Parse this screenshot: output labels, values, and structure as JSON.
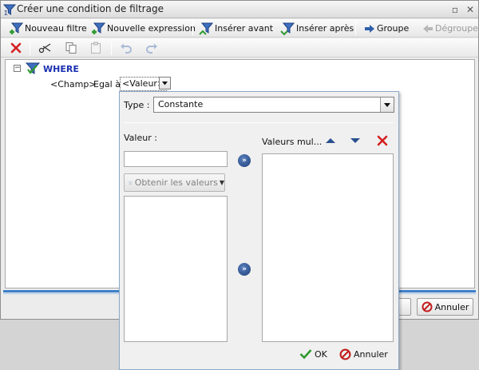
{
  "window": {
    "title": "Créer une condition de filtrage",
    "minimize_glyph": "▫",
    "close_glyph": "✕"
  },
  "toolbar": {
    "new_filter": "Nouveau filtre",
    "new_expression": "Nouvelle expression",
    "insert_before": "Insérer avant",
    "insert_after": "Insérer après",
    "group": "Groupe",
    "ungroup": "Dégrouper"
  },
  "icons": {
    "app": "filter-icon",
    "new_filter": "filter-add-icon",
    "new_expression": "filter-add-icon",
    "insert_before": "filter-insert-before-icon",
    "insert_after": "filter-insert-after-icon",
    "group": "arrow-right-icon",
    "ungroup": "arrow-left-icon",
    "delete": "delete-x-icon",
    "cut": "scissors-icon",
    "copy": "copy-icon",
    "paste": "paste-icon",
    "undo": "undo-icon",
    "redo": "redo-icon"
  },
  "tree": {
    "collapse_glyph": "−",
    "root_label": "WHERE",
    "condition": {
      "field": "<Champ>",
      "operator": "Egal à",
      "value": "<Valeur>"
    }
  },
  "dialog_buttons": {
    "cancel": "Annuler"
  },
  "popup": {
    "type_label": "Type :",
    "type_value": "Constante",
    "value_label": "Valeur :",
    "value_input": "",
    "obtain_values": "Obtenir les valeurs",
    "multi_values_label": "Valeurs mul...",
    "arrow_glyph": "»",
    "ok": "OK",
    "cancel": "Annuler",
    "available_values": [],
    "selected_values": []
  },
  "colors": {
    "accent_blue": "#3d7fc9",
    "where_text": "#1a2fb0",
    "delete_red": "#d42020",
    "ok_green": "#2e9a2e"
  }
}
